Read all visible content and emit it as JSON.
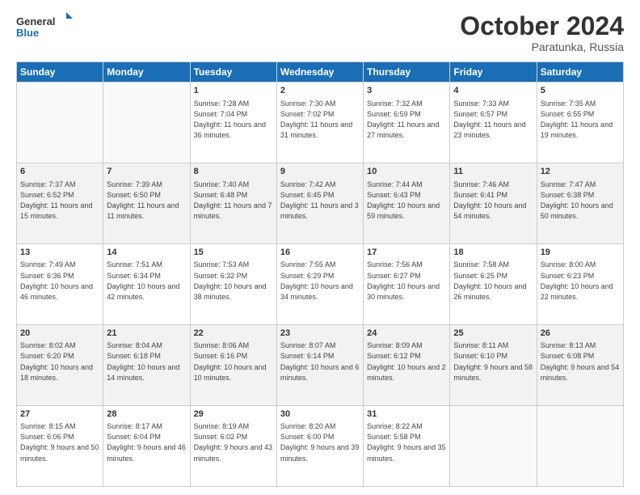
{
  "logo": {
    "line1": "General",
    "line2": "Blue"
  },
  "title": "October 2024",
  "subtitle": "Paratunka, Russia",
  "days_header": [
    "Sunday",
    "Monday",
    "Tuesday",
    "Wednesday",
    "Thursday",
    "Friday",
    "Saturday"
  ],
  "weeks": [
    [
      {
        "day": "",
        "info": ""
      },
      {
        "day": "",
        "info": ""
      },
      {
        "day": "1",
        "info": "Sunrise: 7:28 AM\nSunset: 7:04 PM\nDaylight: 11 hours and 36 minutes."
      },
      {
        "day": "2",
        "info": "Sunrise: 7:30 AM\nSunset: 7:02 PM\nDaylight: 11 hours and 31 minutes."
      },
      {
        "day": "3",
        "info": "Sunrise: 7:32 AM\nSunset: 6:59 PM\nDaylight: 11 hours and 27 minutes."
      },
      {
        "day": "4",
        "info": "Sunrise: 7:33 AM\nSunset: 6:57 PM\nDaylight: 11 hours and 23 minutes."
      },
      {
        "day": "5",
        "info": "Sunrise: 7:35 AM\nSunset: 6:55 PM\nDaylight: 11 hours and 19 minutes."
      }
    ],
    [
      {
        "day": "6",
        "info": "Sunrise: 7:37 AM\nSunset: 6:52 PM\nDaylight: 11 hours and 15 minutes."
      },
      {
        "day": "7",
        "info": "Sunrise: 7:39 AM\nSunset: 6:50 PM\nDaylight: 11 hours and 11 minutes."
      },
      {
        "day": "8",
        "info": "Sunrise: 7:40 AM\nSunset: 6:48 PM\nDaylight: 11 hours and 7 minutes."
      },
      {
        "day": "9",
        "info": "Sunrise: 7:42 AM\nSunset: 6:45 PM\nDaylight: 11 hours and 3 minutes."
      },
      {
        "day": "10",
        "info": "Sunrise: 7:44 AM\nSunset: 6:43 PM\nDaylight: 10 hours and 59 minutes."
      },
      {
        "day": "11",
        "info": "Sunrise: 7:46 AM\nSunset: 6:41 PM\nDaylight: 10 hours and 54 minutes."
      },
      {
        "day": "12",
        "info": "Sunrise: 7:47 AM\nSunset: 6:38 PM\nDaylight: 10 hours and 50 minutes."
      }
    ],
    [
      {
        "day": "13",
        "info": "Sunrise: 7:49 AM\nSunset: 6:36 PM\nDaylight: 10 hours and 46 minutes."
      },
      {
        "day": "14",
        "info": "Sunrise: 7:51 AM\nSunset: 6:34 PM\nDaylight: 10 hours and 42 minutes."
      },
      {
        "day": "15",
        "info": "Sunrise: 7:53 AM\nSunset: 6:32 PM\nDaylight: 10 hours and 38 minutes."
      },
      {
        "day": "16",
        "info": "Sunrise: 7:55 AM\nSunset: 6:29 PM\nDaylight: 10 hours and 34 minutes."
      },
      {
        "day": "17",
        "info": "Sunrise: 7:56 AM\nSunset: 6:27 PM\nDaylight: 10 hours and 30 minutes."
      },
      {
        "day": "18",
        "info": "Sunrise: 7:58 AM\nSunset: 6:25 PM\nDaylight: 10 hours and 26 minutes."
      },
      {
        "day": "19",
        "info": "Sunrise: 8:00 AM\nSunset: 6:23 PM\nDaylight: 10 hours and 22 minutes."
      }
    ],
    [
      {
        "day": "20",
        "info": "Sunrise: 8:02 AM\nSunset: 6:20 PM\nDaylight: 10 hours and 18 minutes."
      },
      {
        "day": "21",
        "info": "Sunrise: 8:04 AM\nSunset: 6:18 PM\nDaylight: 10 hours and 14 minutes."
      },
      {
        "day": "22",
        "info": "Sunrise: 8:06 AM\nSunset: 6:16 PM\nDaylight: 10 hours and 10 minutes."
      },
      {
        "day": "23",
        "info": "Sunrise: 8:07 AM\nSunset: 6:14 PM\nDaylight: 10 hours and 6 minutes."
      },
      {
        "day": "24",
        "info": "Sunrise: 8:09 AM\nSunset: 6:12 PM\nDaylight: 10 hours and 2 minutes."
      },
      {
        "day": "25",
        "info": "Sunrise: 8:11 AM\nSunset: 6:10 PM\nDaylight: 9 hours and 58 minutes."
      },
      {
        "day": "26",
        "info": "Sunrise: 8:13 AM\nSunset: 6:08 PM\nDaylight: 9 hours and 54 minutes."
      }
    ],
    [
      {
        "day": "27",
        "info": "Sunrise: 8:15 AM\nSunset: 6:06 PM\nDaylight: 9 hours and 50 minutes."
      },
      {
        "day": "28",
        "info": "Sunrise: 8:17 AM\nSunset: 6:04 PM\nDaylight: 9 hours and 46 minutes."
      },
      {
        "day": "29",
        "info": "Sunrise: 8:19 AM\nSunset: 6:02 PM\nDaylight: 9 hours and 43 minutes."
      },
      {
        "day": "30",
        "info": "Sunrise: 8:20 AM\nSunset: 6:00 PM\nDaylight: 9 hours and 39 minutes."
      },
      {
        "day": "31",
        "info": "Sunrise: 8:22 AM\nSunset: 5:58 PM\nDaylight: 9 hours and 35 minutes."
      },
      {
        "day": "",
        "info": ""
      },
      {
        "day": "",
        "info": ""
      }
    ]
  ]
}
